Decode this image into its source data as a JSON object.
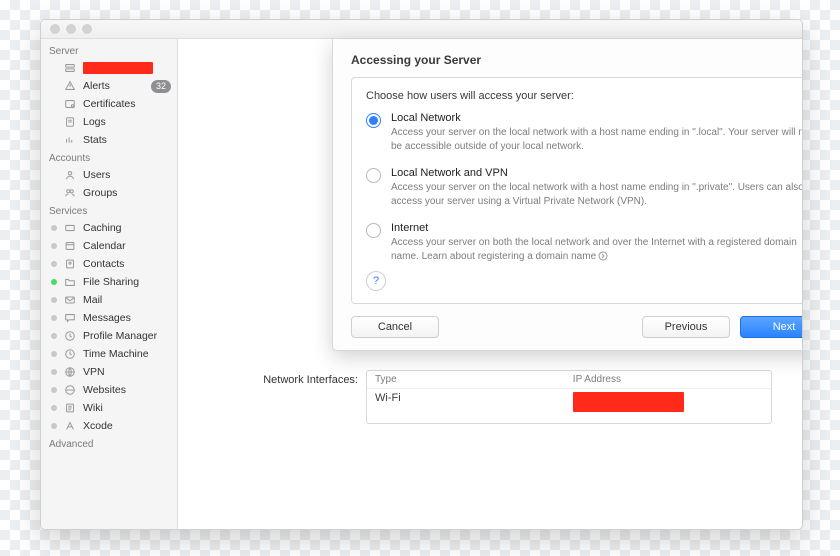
{
  "sidebar": {
    "groups": [
      {
        "header": "Server",
        "items": [
          {
            "label": "",
            "icon": "server-icon",
            "status": "",
            "red": true
          },
          {
            "label": "Alerts",
            "icon": "alert-icon",
            "status": "",
            "badge": "32"
          },
          {
            "label": "Certificates",
            "icon": "certificate-icon",
            "status": ""
          },
          {
            "label": "Logs",
            "icon": "logs-icon",
            "status": ""
          },
          {
            "label": "Stats",
            "icon": "stats-icon",
            "status": ""
          }
        ]
      },
      {
        "header": "Accounts",
        "items": [
          {
            "label": "Users",
            "icon": "user-icon",
            "status": ""
          },
          {
            "label": "Groups",
            "icon": "group-icon",
            "status": ""
          }
        ]
      },
      {
        "header": "Services",
        "items": [
          {
            "label": "Caching",
            "icon": "caching-icon",
            "status": "grey"
          },
          {
            "label": "Calendar",
            "icon": "calendar-icon",
            "status": "grey"
          },
          {
            "label": "Contacts",
            "icon": "contacts-icon",
            "status": "grey"
          },
          {
            "label": "File Sharing",
            "icon": "folder-icon",
            "status": "green"
          },
          {
            "label": "Mail",
            "icon": "mail-icon",
            "status": "grey"
          },
          {
            "label": "Messages",
            "icon": "messages-icon",
            "status": "grey"
          },
          {
            "label": "Profile Manager",
            "icon": "profile-icon",
            "status": "grey"
          },
          {
            "label": "Time Machine",
            "icon": "timemachine-icon",
            "status": "grey"
          },
          {
            "label": "VPN",
            "icon": "vpn-icon",
            "status": "grey"
          },
          {
            "label": "Websites",
            "icon": "websites-icon",
            "status": "grey"
          },
          {
            "label": "Wiki",
            "icon": "wiki-icon",
            "status": "grey"
          },
          {
            "label": "Xcode",
            "icon": "xcode-icon",
            "status": "grey"
          }
        ]
      },
      {
        "header": "Advanced",
        "items": []
      }
    ]
  },
  "sheet": {
    "title": "Accessing your Server",
    "prompt": "Choose how users will access your server:",
    "options": [
      {
        "title": "Local Network",
        "desc": "Access your server on the local network with a host name ending in \".local\". Your server will not be accessible outside of your local network.",
        "selected": true
      },
      {
        "title": "Local Network and VPN",
        "desc": "Access your server on the local network with a host name ending in \".private\". Users can also access your server using a Virtual Private Network (VPN).",
        "selected": false
      },
      {
        "title": "Internet",
        "desc": "Access your server on both the local network and over the Internet with a registered domain name. Learn about registering a domain name",
        "selected": false,
        "chevron": true
      }
    ],
    "help": "?",
    "cancel": "Cancel",
    "previous": "Previous",
    "next": "Next"
  },
  "network": {
    "label": "Network Interfaces:",
    "col_type": "Type",
    "col_ip": "IP Address",
    "rows": [
      {
        "type": "Wi-Fi",
        "ip": "",
        "ip_red": true
      }
    ]
  }
}
